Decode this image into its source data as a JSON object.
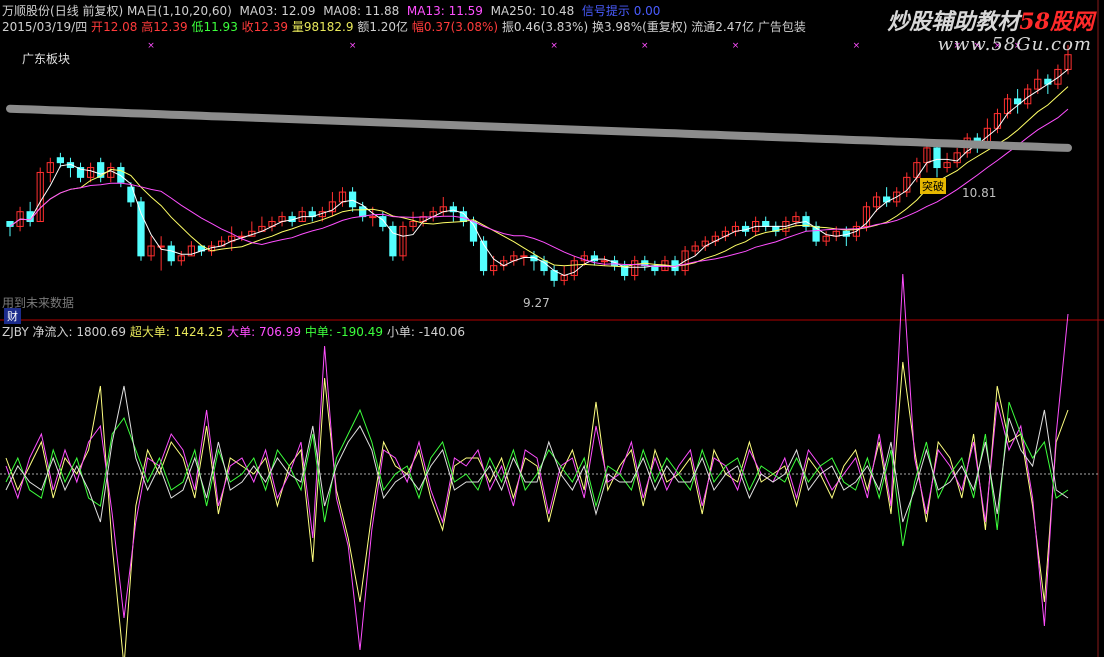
{
  "header": {
    "stock": "万顺股份",
    "period": "(日线 前复权)",
    "ma_label": "MA日(1,10,20,60)",
    "ma03": "MA03: 12.09",
    "ma08": "MA08: 11.88",
    "ma13": "MA13: 11.59",
    "ma250": "MA250: 10.48",
    "extra": "信号提示 0.00"
  },
  "quote": {
    "date": "2015/03/19/四",
    "open_label": "开",
    "open": "12.08",
    "high_label": "高",
    "high": "12.39",
    "low_label": "低",
    "low": "11.93",
    "close_label": "收",
    "close": "12.39",
    "volume": "量98182.9",
    "amount": "额1.20亿",
    "change_label": "幅",
    "change": "0.37(3.08%)",
    "amplitude": "振0.46(3.83%)",
    "turnover": "换3.98%(重复权)",
    "float": "流通2.47亿",
    "industry": "广告包装"
  },
  "watermark": {
    "part1": "炒股辅助教材",
    "part2": "58股网",
    "url": "www.58Gu.com"
  },
  "sector_label": "广东板块",
  "future_note": "用到未来数据",
  "fin_badge": "财",
  "price_labels": {
    "low": "9.27",
    "high": "10.81",
    "cross_tag": "突破"
  },
  "indicator": {
    "name": "ZJBY",
    "net_label": "净流入: ",
    "net": "1800.69",
    "super_label": "超大单: ",
    "super": "1424.25",
    "large_label": "大单: ",
    "large": "706.99",
    "medium_label": "中单: ",
    "medium": "-190.49",
    "small_label": "小单: ",
    "small": "-140.06"
  },
  "colors": {
    "up": "#ff3030",
    "down": "#54ffff",
    "ma_white": "#ffffff",
    "ma_yellow": "#ffff66",
    "ma_magenta": "#ff4fff",
    "ma_long": "#8c8c8c",
    "separator": "#b00000",
    "grid": "#8a1a1a"
  },
  "chart_data": {
    "type": "candlestick",
    "ohlc": [
      [
        10.6,
        10.5,
        10.3,
        10.6
      ],
      [
        10.5,
        10.8,
        10.4,
        10.9
      ],
      [
        10.8,
        10.6,
        10.5,
        11.0
      ],
      [
        10.6,
        11.6,
        10.6,
        11.7
      ],
      [
        11.6,
        11.8,
        11.4,
        11.9
      ],
      [
        11.9,
        11.8,
        11.7,
        12.0
      ],
      [
        11.8,
        11.7,
        11.5,
        11.9
      ],
      [
        11.7,
        11.5,
        11.4,
        11.8
      ],
      [
        11.5,
        11.7,
        11.4,
        11.8
      ],
      [
        11.8,
        11.5,
        11.4,
        11.9
      ],
      [
        11.5,
        11.7,
        11.4,
        11.8
      ],
      [
        11.7,
        11.4,
        11.3,
        11.8
      ],
      [
        11.3,
        11.0,
        10.9,
        11.4
      ],
      [
        11.0,
        9.9,
        9.8,
        11.1
      ],
      [
        9.9,
        10.1,
        9.8,
        10.3
      ],
      [
        10.1,
        10.1,
        9.6,
        10.3
      ],
      [
        10.1,
        9.8,
        9.7,
        10.2
      ],
      [
        9.8,
        9.9,
        9.7,
        10.0
      ],
      [
        9.9,
        10.1,
        9.9,
        10.2
      ],
      [
        10.1,
        10.0,
        9.9,
        10.1
      ],
      [
        10.0,
        10.1,
        9.9,
        10.2
      ],
      [
        10.1,
        10.2,
        10.1,
        10.3
      ],
      [
        10.2,
        10.3,
        10.0,
        10.5
      ],
      [
        10.3,
        10.3,
        10.2,
        10.4
      ],
      [
        10.3,
        10.4,
        10.3,
        10.6
      ],
      [
        10.4,
        10.5,
        10.4,
        10.7
      ],
      [
        10.5,
        10.6,
        10.4,
        10.7
      ],
      [
        10.6,
        10.7,
        10.5,
        10.8
      ],
      [
        10.7,
        10.6,
        10.5,
        10.8
      ],
      [
        10.6,
        10.8,
        10.6,
        10.9
      ],
      [
        10.8,
        10.7,
        10.6,
        10.9
      ],
      [
        10.7,
        10.8,
        10.6,
        10.9
      ],
      [
        10.8,
        11.0,
        10.7,
        11.2
      ],
      [
        11.0,
        11.2,
        10.9,
        11.3
      ],
      [
        11.2,
        10.9,
        10.8,
        11.3
      ],
      [
        10.9,
        10.7,
        10.6,
        11.0
      ],
      [
        10.7,
        10.7,
        10.5,
        10.9
      ],
      [
        10.7,
        10.5,
        10.4,
        10.8
      ],
      [
        10.5,
        9.9,
        9.8,
        10.6
      ],
      [
        9.9,
        10.5,
        9.8,
        10.6
      ],
      [
        10.5,
        10.6,
        10.4,
        10.8
      ],
      [
        10.6,
        10.7,
        10.5,
        10.8
      ],
      [
        10.7,
        10.8,
        10.6,
        10.9
      ],
      [
        10.8,
        10.9,
        10.7,
        11.1
      ],
      [
        10.9,
        10.8,
        10.6,
        11.0
      ],
      [
        10.8,
        10.6,
        10.5,
        10.9
      ],
      [
        10.6,
        10.2,
        10.1,
        10.7
      ],
      [
        10.2,
        9.6,
        9.5,
        10.3
      ],
      [
        9.6,
        9.7,
        9.5,
        9.9
      ],
      [
        9.7,
        9.8,
        9.6,
        9.9
      ],
      [
        9.8,
        9.9,
        9.7,
        10.0
      ],
      [
        9.9,
        9.9,
        9.7,
        10.0
      ],
      [
        9.9,
        9.8,
        9.6,
        10.0
      ],
      [
        9.8,
        9.6,
        9.5,
        9.9
      ],
      [
        9.6,
        9.4,
        9.27,
        9.7
      ],
      [
        9.4,
        9.5,
        9.3,
        9.7
      ],
      [
        9.5,
        9.8,
        9.4,
        9.9
      ],
      [
        9.8,
        9.9,
        9.7,
        10.0
      ],
      [
        9.9,
        9.8,
        9.7,
        10.0
      ],
      [
        9.8,
        9.8,
        9.7,
        9.9
      ],
      [
        9.8,
        9.7,
        9.6,
        9.9
      ],
      [
        9.7,
        9.5,
        9.4,
        9.8
      ],
      [
        9.5,
        9.8,
        9.4,
        9.9
      ],
      [
        9.8,
        9.7,
        9.6,
        9.9
      ],
      [
        9.7,
        9.6,
        9.5,
        9.8
      ],
      [
        9.6,
        9.8,
        9.6,
        9.9
      ],
      [
        9.8,
        9.6,
        9.5,
        9.9
      ],
      [
        9.6,
        10.0,
        9.5,
        10.1
      ],
      [
        10.0,
        10.1,
        9.9,
        10.2
      ],
      [
        10.1,
        10.2,
        10.0,
        10.3
      ],
      [
        10.2,
        10.3,
        10.1,
        10.4
      ],
      [
        10.3,
        10.4,
        10.2,
        10.5
      ],
      [
        10.4,
        10.5,
        10.3,
        10.6
      ],
      [
        10.5,
        10.4,
        10.3,
        10.6
      ],
      [
        10.4,
        10.6,
        10.3,
        10.7
      ],
      [
        10.6,
        10.5,
        10.4,
        10.7
      ],
      [
        10.5,
        10.4,
        10.3,
        10.6
      ],
      [
        10.4,
        10.6,
        10.3,
        10.7
      ],
      [
        10.6,
        10.7,
        10.5,
        10.8
      ],
      [
        10.7,
        10.5,
        10.4,
        10.8
      ],
      [
        10.5,
        10.2,
        10.1,
        10.6
      ],
      [
        10.2,
        10.3,
        10.1,
        10.4
      ],
      [
        10.3,
        10.4,
        10.2,
        10.5
      ],
      [
        10.4,
        10.3,
        10.1,
        10.5
      ],
      [
        10.3,
        10.5,
        10.2,
        10.6
      ],
      [
        10.5,
        10.9,
        10.4,
        11.0
      ],
      [
        10.9,
        11.1,
        10.8,
        11.2
      ],
      [
        11.1,
        11.0,
        10.9,
        11.3
      ],
      [
        11.0,
        11.2,
        10.9,
        11.3
      ],
      [
        11.2,
        11.5,
        11.1,
        11.6
      ],
      [
        11.5,
        11.8,
        11.4,
        11.9
      ],
      [
        11.8,
        12.1,
        11.6,
        12.2
      ],
      [
        12.1,
        11.7,
        11.5,
        12.2
      ],
      [
        11.7,
        11.8,
        11.6,
        12.0
      ],
      [
        11.8,
        12.0,
        11.7,
        12.1
      ],
      [
        12.0,
        12.3,
        11.9,
        12.4
      ],
      [
        12.3,
        12.2,
        12.0,
        12.4
      ],
      [
        12.2,
        12.5,
        12.1,
        12.7
      ],
      [
        12.5,
        12.8,
        12.4,
        12.9
      ],
      [
        12.8,
        13.1,
        12.7,
        13.2
      ],
      [
        13.1,
        13.0,
        12.8,
        13.3
      ],
      [
        13.0,
        13.3,
        12.9,
        13.4
      ],
      [
        13.3,
        13.5,
        13.2,
        13.7
      ],
      [
        13.5,
        13.4,
        13.2,
        13.6
      ],
      [
        13.4,
        13.7,
        13.3,
        13.8
      ],
      [
        13.7,
        14.0,
        13.6,
        14.2
      ]
    ],
    "yrange": [
      9.0,
      14.3
    ],
    "ma_long": [
      12.9,
      12.1
    ],
    "flow_series": {
      "net": [
        0.1,
        -0.3,
        0.2,
        0.5,
        -0.2,
        0.3,
        -0.1,
        0.4,
        0.6,
        -0.5,
        -1.8,
        -0.6,
        0.2,
        0.1,
        0.5,
        0.3,
        -0.2,
        0.8,
        -0.4,
        0.1,
        0.2,
        -0.1,
        0.3,
        -0.3,
        0.0,
        0.4,
        -0.8,
        1.6,
        -0.3,
        -0.9,
        -2.2,
        -0.7,
        0.3,
        0.2,
        -0.1,
        0.4,
        -0.2,
        -0.6,
        0.2,
        0.1,
        0.3,
        -0.2,
        0.1,
        -0.4,
        0.3,
        0.2,
        -0.5,
        0.1,
        0.2,
        -0.3,
        0.6,
        -0.1,
        0.0,
        0.4,
        -0.3,
        0.2,
        -0.2,
        0.1,
        0.3,
        -0.4,
        0.2,
        0.1,
        -0.2,
        0.3,
        0.0,
        -0.1,
        0.2,
        -0.3,
        0.3,
        0.1,
        -0.2,
        0.0,
        0.2,
        -0.3,
        0.5,
        -0.4,
        2.5,
        0.2,
        -0.5,
        0.3,
        0.1,
        -0.2,
        0.4,
        -0.6,
        0.9,
        0.3,
        0.6,
        -0.3,
        -1.9,
        0.5,
        2.0
      ],
      "super": [
        0.2,
        -0.2,
        0.1,
        0.4,
        -0.3,
        0.2,
        0.0,
        0.3,
        1.1,
        -0.9,
        -2.4,
        -0.4,
        0.3,
        0.0,
        0.4,
        0.2,
        -0.3,
        0.6,
        -0.5,
        0.2,
        0.1,
        0.0,
        0.2,
        -0.4,
        0.1,
        0.3,
        -1.1,
        1.2,
        -0.2,
        -0.8,
        -1.6,
        -0.5,
        0.4,
        0.1,
        0.0,
        0.3,
        -0.3,
        -0.7,
        0.1,
        0.2,
        0.2,
        -0.1,
        0.2,
        -0.3,
        0.2,
        0.1,
        -0.6,
        0.0,
        0.3,
        -0.2,
        0.9,
        -0.2,
        0.1,
        0.3,
        -0.4,
        0.3,
        -0.1,
        0.0,
        0.2,
        -0.5,
        0.3,
        0.0,
        -0.1,
        0.4,
        -0.1,
        0.0,
        0.1,
        -0.4,
        0.2,
        0.0,
        -0.3,
        0.1,
        0.3,
        -0.2,
        0.4,
        -0.5,
        1.4,
        0.3,
        -0.6,
        0.4,
        0.2,
        -0.3,
        0.5,
        -0.7,
        1.1,
        0.4,
        0.5,
        -0.4,
        -1.6,
        0.4,
        0.8
      ],
      "medium": [
        -0.1,
        0.2,
        -0.2,
        -0.3,
        0.3,
        -0.1,
        0.2,
        -0.3,
        -0.4,
        0.5,
        0.7,
        0.3,
        -0.1,
        0.2,
        -0.2,
        -0.1,
        0.3,
        -0.4,
        0.3,
        -0.1,
        0.0,
        0.2,
        -0.2,
        0.3,
        0.1,
        -0.2,
        0.5,
        -0.6,
        0.2,
        0.5,
        0.8,
        0.4,
        -0.2,
        0.0,
        0.1,
        -0.3,
        0.2,
        0.4,
        -0.1,
        0.0,
        -0.2,
        0.2,
        -0.1,
        0.3,
        -0.2,
        0.0,
        0.3,
        0.1,
        -0.1,
        0.2,
        -0.4,
        0.1,
        0.0,
        -0.2,
        0.3,
        -0.1,
        0.2,
        0.0,
        -0.2,
        0.3,
        -0.1,
        0.1,
        0.2,
        -0.2,
        0.1,
        0.0,
        -0.1,
        0.2,
        -0.1,
        0.1,
        0.2,
        -0.1,
        -0.2,
        0.2,
        -0.3,
        0.3,
        -0.9,
        -0.1,
        0.4,
        -0.3,
        0.0,
        0.2,
        -0.3,
        0.5,
        -0.7,
        0.9,
        0.5,
        0.2,
        0.4,
        -0.3,
        -0.2
      ],
      "small": [
        -0.2,
        0.1,
        -0.1,
        -0.2,
        0.2,
        -0.2,
        0.1,
        -0.2,
        -0.6,
        0.4,
        1.1,
        0.2,
        -0.2,
        0.1,
        -0.3,
        -0.2,
        0.2,
        -0.3,
        0.4,
        -0.2,
        -0.1,
        0.1,
        -0.1,
        0.2,
        0.0,
        -0.1,
        0.6,
        -0.4,
        0.1,
        0.4,
        0.6,
        0.3,
        -0.3,
        -0.1,
        0.0,
        -0.2,
        0.1,
        0.3,
        -0.2,
        -0.1,
        -0.1,
        0.1,
        -0.2,
        0.2,
        -0.1,
        -0.1,
        0.4,
        0.0,
        -0.2,
        0.1,
        -0.5,
        0.0,
        -0.1,
        -0.1,
        0.2,
        -0.2,
        0.1,
        -0.1,
        -0.1,
        0.2,
        -0.2,
        0.0,
        0.1,
        -0.3,
        0.0,
        -0.1,
        0.0,
        0.3,
        -0.2,
        0.0,
        0.1,
        -0.2,
        -0.1,
        0.1,
        -0.2,
        0.4,
        -0.6,
        -0.2,
        0.3,
        -0.2,
        -0.1,
        0.1,
        -0.2,
        0.4,
        -0.5,
        0.7,
        0.3,
        0.1,
        0.8,
        -0.2,
        -0.3
      ]
    }
  }
}
